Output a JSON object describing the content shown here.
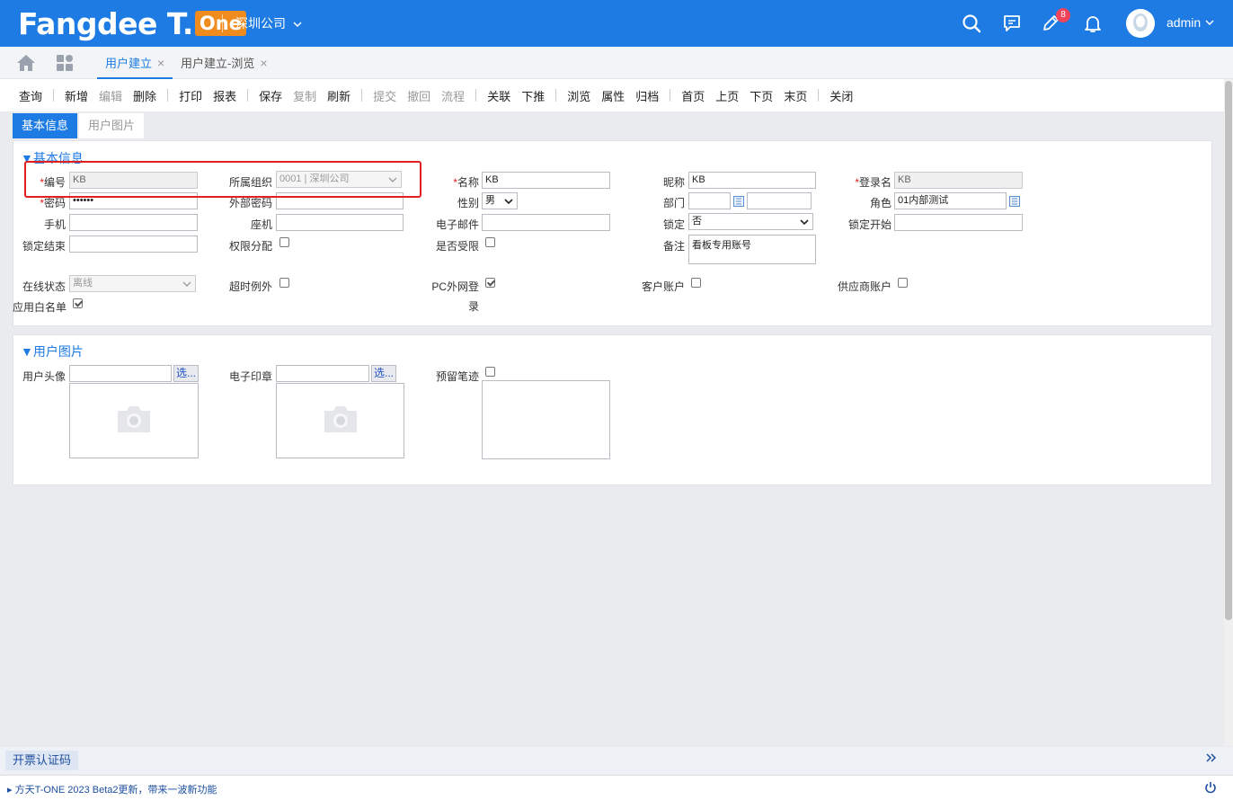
{
  "header": {
    "logo_main": "Fangdee T.",
    "logo_badge": "One",
    "company": "深圳公司",
    "badge_count": "8",
    "username": "admin",
    "brand_color": "#1d7be3",
    "accent_color": "#f08c1e"
  },
  "tabs": [
    {
      "label": "用户建立",
      "close": "×"
    },
    {
      "label": "用户建立-浏览",
      "close": "×"
    }
  ],
  "toolbar": {
    "query": "查询",
    "add": "新增",
    "edit": "编辑",
    "delete": "删除",
    "print": "打印",
    "report": "报表",
    "save": "保存",
    "copy": "复制",
    "refresh": "刷新",
    "submit": "提交",
    "withdraw": "撤回",
    "flow": "流程",
    "link": "关联",
    "push": "下推",
    "browse": "浏览",
    "props": "属性",
    "archive": "归档",
    "first": "首页",
    "prev": "上页",
    "next": "下页",
    "last": "末页",
    "close": "关闭"
  },
  "subtabs": {
    "basic": "基本信息",
    "images": "用户图片"
  },
  "basic": {
    "title": "▼基本信息",
    "code_label": "编号",
    "code_value": "KB",
    "org_label": "所属组织",
    "org_value": "0001 | 深圳公司",
    "name_label": "名称",
    "name_value": "KB",
    "nick_label": "昵称",
    "nick_value": "KB",
    "login_label": "登录名",
    "login_value": "KB",
    "pwd_label": "密码",
    "pwd_value": "••••••",
    "extpwd_label": "外部密码",
    "gender_label": "性别",
    "gender_value": "男",
    "dept_label": "部门",
    "role_label": "角色",
    "role_value": "01内部测试",
    "mobile_label": "手机",
    "phone_label": "座机",
    "email_label": "电子邮件",
    "lock_label": "锁定",
    "lock_value": "否",
    "lock_start_label": "锁定开始",
    "lock_end_label": "锁定结束",
    "perm_label": "权限分配",
    "limited_label": "是否受限",
    "remark_label": "备注",
    "remark_value": "看板专用账号",
    "online_label": "在线状态",
    "online_value": "离线",
    "timeout_label": "超时例外",
    "pc_login_label_1": "PC外网登",
    "pc_login_label_2": "录",
    "customer_label": "客户账户",
    "supplier_label": "供应商账户",
    "whitelist_label": "应用白名单",
    "required_mark": "*"
  },
  "images": {
    "title": "▼用户图片",
    "avatar_label": "用户头像",
    "seal_label": "电子印章",
    "sign_label": "预留笔迹",
    "pick": "选..."
  },
  "footer": {
    "invoice_code": "开票认证码",
    "news": "方天T-ONE 2023 Beta2更新，带来一波新功能"
  }
}
